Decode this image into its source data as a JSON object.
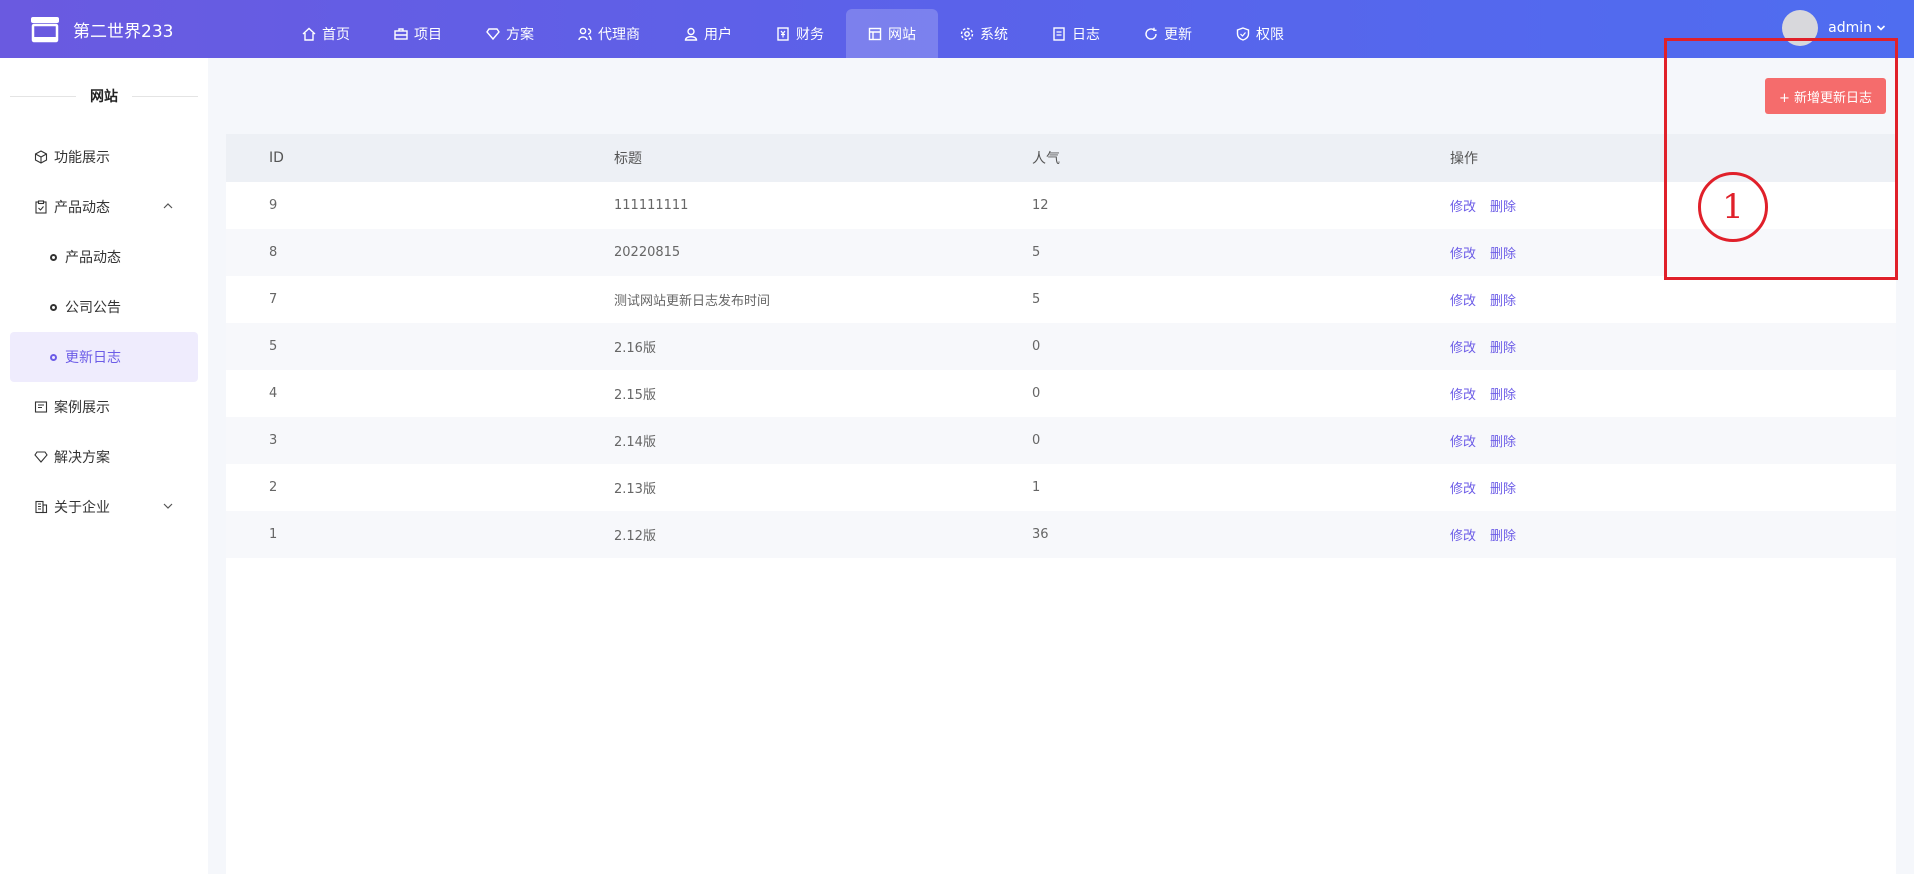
{
  "brand": {
    "name": "第二世界233",
    "logo_icon": "store-icon"
  },
  "nav": [
    {
      "label": "首页",
      "icon": "home-icon"
    },
    {
      "label": "项目",
      "icon": "briefcase-icon"
    },
    {
      "label": "方案",
      "icon": "diamond-icon"
    },
    {
      "label": "代理商",
      "icon": "users-icon"
    },
    {
      "label": "用户",
      "icon": "user-icon"
    },
    {
      "label": "财务",
      "icon": "finance-icon"
    },
    {
      "label": "网站",
      "icon": "website-icon",
      "active": true
    },
    {
      "label": "系统",
      "icon": "gear-icon"
    },
    {
      "label": "日志",
      "icon": "log-icon"
    },
    {
      "label": "更新",
      "icon": "refresh-icon"
    },
    {
      "label": "权限",
      "icon": "shield-icon"
    }
  ],
  "user": {
    "name": "admin"
  },
  "sidebar": {
    "title": "网站",
    "items": [
      {
        "label": "功能展示"
      },
      {
        "label": "产品动态"
      },
      {
        "label": "产品动态"
      },
      {
        "label": "公司公告"
      },
      {
        "label": "更新日志"
      },
      {
        "label": "案例展示"
      },
      {
        "label": "解决方案"
      },
      {
        "label": "关于企业"
      }
    ]
  },
  "toolbar": {
    "add_label": "+ 新增更新日志"
  },
  "table": {
    "headers": [
      "ID",
      "标题",
      "人气",
      "操作"
    ],
    "edit_label": "修改",
    "delete_label": "删除",
    "rows": [
      [
        "9",
        "111111111",
        "12"
      ],
      [
        "8",
        "20220815",
        "5"
      ],
      [
        "7",
        "测试网站更新日志发布时间",
        "5"
      ],
      [
        "5",
        "2.16版",
        "0"
      ],
      [
        "4",
        "2.15版",
        "0"
      ],
      [
        "3",
        "2.14版",
        "0"
      ],
      [
        "2",
        "2.13版",
        "1"
      ],
      [
        "1",
        "2.12版",
        "36"
      ]
    ]
  },
  "annotation": {
    "number": "1",
    "color": "#e0202a"
  },
  "colors": {
    "accent": "#6c5ce7",
    "danger": "#f56c6c"
  }
}
